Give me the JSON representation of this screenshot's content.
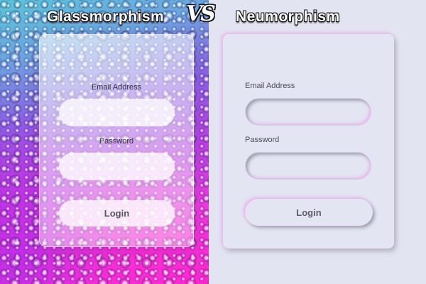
{
  "header": {
    "left_title": "Glassmorphism",
    "vs": "VS",
    "right_title": "Neumorphism"
  },
  "glass_form": {
    "email_label": "Email Address",
    "email_value": "",
    "password_label": "Password",
    "password_value": "",
    "login_label": "Login"
  },
  "neumorph_form": {
    "email_label": "Email Address",
    "email_value": "",
    "password_label": "Password",
    "password_value": "",
    "login_label": "Login"
  },
  "colors": {
    "neumorph_background": "#e3e5f2",
    "glow_accent": "#ff78f0",
    "backdrop_magenta": "#ff1ec8",
    "backdrop_cyan": "#58c6d8"
  }
}
